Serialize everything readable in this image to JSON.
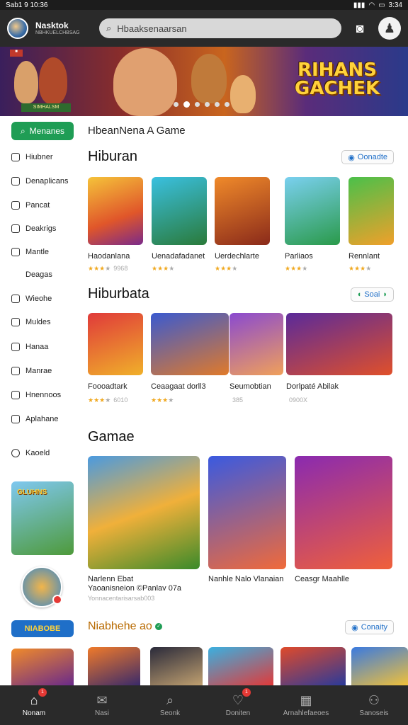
{
  "status_bar": {
    "time": "Sab1 9 10:36",
    "battery": "3:34"
  },
  "top_bar": {
    "brand_title": "Nasktok",
    "brand_subtitle": "NBHKUELCHBSAG",
    "search_placeholder": "Hbaaksenaarsan"
  },
  "banner": {
    "title": "RIHANS GACHEK",
    "sign": "SIMHALSM",
    "dots": 6,
    "active_dot": 1
  },
  "sidebar": {
    "main_button": "Menanes",
    "items": [
      {
        "label": "Hiubner",
        "icon": "chat-icon"
      },
      {
        "label": "Denaplicans",
        "icon": "chart-icon"
      },
      {
        "label": "Pancat",
        "icon": "list-icon"
      },
      {
        "label": "Deakrigs",
        "icon": "trend-icon"
      },
      {
        "label": "Mantle",
        "icon": "clock-icon"
      },
      {
        "label": "Deagas",
        "icon": ""
      },
      {
        "label": "Wieohe",
        "icon": "gamepad-icon"
      },
      {
        "label": "Muldes",
        "icon": "doc-icon"
      },
      {
        "label": "Hanaa",
        "icon": "box-icon"
      },
      {
        "label": "Manrae",
        "icon": "person-icon"
      },
      {
        "label": "Hnennoos",
        "icon": "tag-icon"
      },
      {
        "label": "Aplahane",
        "icon": "compass-icon"
      },
      {
        "label": "Kaoeld",
        "icon": "circle-icon"
      }
    ],
    "promo_pill": "NIABOBE"
  },
  "main": {
    "breadcrumb": "HbeanNena A Game",
    "sections": [
      {
        "title": "Hiburan",
        "button": "Oonadte",
        "tiles": [
          {
            "name": "Haodanlana",
            "rating": "3",
            "count": "9968"
          },
          {
            "name": "Uenadafadanet",
            "rating": "3",
            "count": ""
          },
          {
            "name": "Uerdechlarte",
            "rating": "3",
            "count": ""
          },
          {
            "name": "Parliaos",
            "rating": "3",
            "count": ""
          },
          {
            "name": "Rennlant",
            "rating": "3",
            "count": ""
          }
        ]
      },
      {
        "title": "Hiburbata",
        "button": "Soai",
        "tiles": [
          {
            "name": "Foooadtark",
            "rating": "3",
            "count": "6010"
          },
          {
            "name": "Ceaagaat dorll3",
            "rating": "3",
            "count": ""
          },
          {
            "name": "Seumobtian",
            "rating": "0",
            "count": "385"
          },
          {
            "name": "Dorlpaté Abilak",
            "rating": "0",
            "count": "0900X"
          }
        ]
      },
      {
        "title": "Gamae",
        "tiles": [
          {
            "name": "Narlenn Ebat",
            "subtitle": "Yaoanisneion ©Panlav 07a",
            "meta": "Yonnacentarisarsab003"
          },
          {
            "name": "Nanhle Nalo Vlanaian"
          },
          {
            "name": "Ceasgr Maahlle"
          }
        ]
      },
      {
        "title": "Niabhehe ao",
        "button": "Conaity"
      }
    ]
  },
  "bottom_nav": [
    {
      "label": "Nonam",
      "icon": "home-icon",
      "active": true,
      "badge": "1"
    },
    {
      "label": "Nasi",
      "icon": "chat-icon",
      "active": false,
      "badge": ""
    },
    {
      "label": "Seonk",
      "icon": "search-icon",
      "active": false,
      "badge": ""
    },
    {
      "label": "Doniten",
      "icon": "heart-icon",
      "active": false,
      "badge": "1"
    },
    {
      "label": "Arnahlefaeoes",
      "icon": "calendar-icon",
      "active": false,
      "badge": ""
    },
    {
      "label": "Sanoseis",
      "icon": "person-icon",
      "active": false,
      "badge": ""
    }
  ]
}
